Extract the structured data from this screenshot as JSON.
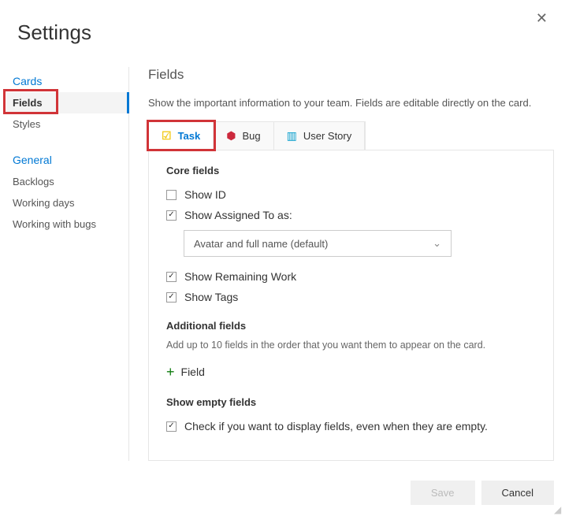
{
  "title": "Settings",
  "closeIcon": "✕",
  "sidebar": {
    "groups": [
      {
        "header": "Cards",
        "items": [
          {
            "label": "Fields",
            "selected": true,
            "highlighted": true
          },
          {
            "label": "Styles"
          }
        ]
      },
      {
        "header": "General",
        "items": [
          {
            "label": "Backlogs"
          },
          {
            "label": "Working days"
          },
          {
            "label": "Working with bugs"
          }
        ]
      }
    ]
  },
  "main": {
    "heading": "Fields",
    "description": "Show the important information to your team. Fields are editable directly on the card.",
    "tabs": [
      {
        "label": "Task",
        "iconName": "clipboard-task-icon",
        "active": true,
        "highlighted": true
      },
      {
        "label": "Bug",
        "iconName": "bug-icon"
      },
      {
        "label": "User Story",
        "iconName": "book-icon"
      }
    ],
    "coreFields": {
      "heading": "Core fields",
      "showId": {
        "label": "Show ID",
        "checked": false
      },
      "showAssigned": {
        "label": "Show Assigned To as:",
        "checked": true,
        "selectValue": "Avatar and full name (default)"
      },
      "showRemaining": {
        "label": "Show Remaining Work",
        "checked": true
      },
      "showTags": {
        "label": "Show Tags",
        "checked": true
      }
    },
    "additionalFields": {
      "heading": "Additional fields",
      "sub": "Add up to 10 fields in the order that you want them to appear on the card.",
      "addLabel": "Field"
    },
    "emptyFields": {
      "heading": "Show empty fields",
      "check": {
        "label": "Check if you want to display fields, even when they are empty.",
        "checked": true
      }
    }
  },
  "footer": {
    "save": "Save",
    "cancel": "Cancel"
  }
}
